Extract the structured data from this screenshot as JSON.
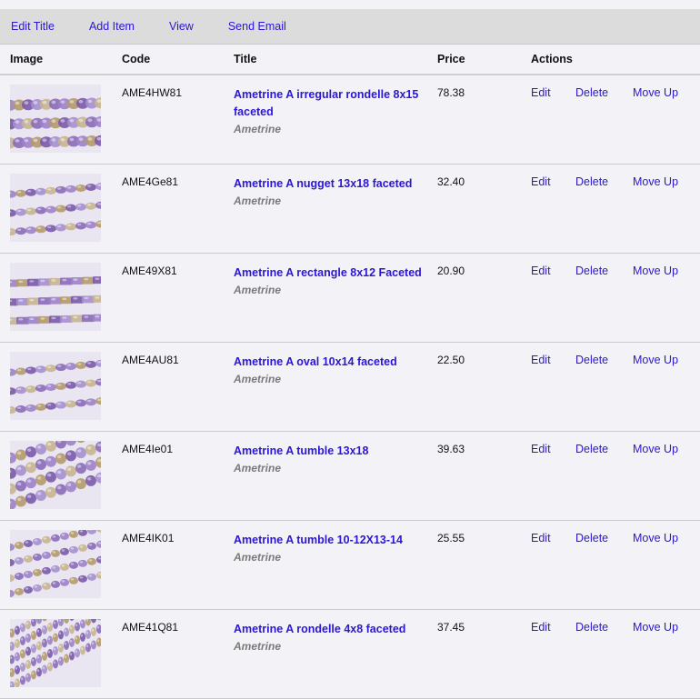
{
  "toolbar": {
    "edit_title": "Edit Title",
    "add_item": "Add Item",
    "view": "View",
    "send_email": "Send Email"
  },
  "table": {
    "headers": [
      "Image",
      "Code",
      "Title",
      "Price",
      "Actions"
    ],
    "actions": {
      "edit": "Edit",
      "delete": "Delete",
      "move_up": "Move Up"
    },
    "rows": [
      {
        "code": "AME4HW81",
        "title": "Ametrine A irregular rondelle 8x15 faceted",
        "subtitle": "Ametrine",
        "price": "78.38",
        "image": "irregular-rondelle"
      },
      {
        "code": "AME4Ge81",
        "title": "Ametrine A nugget 13x18 faceted",
        "subtitle": "Ametrine",
        "price": "32.40",
        "image": "nugget"
      },
      {
        "code": "AME49X81",
        "title": "Ametrine A rectangle 8x12 Faceted",
        "subtitle": "Ametrine",
        "price": "20.90",
        "image": "rectangle"
      },
      {
        "code": "AME4AU81",
        "title": "Ametrine A oval 10x14 faceted",
        "subtitle": "Ametrine",
        "price": "22.50",
        "image": "oval"
      },
      {
        "code": "AME4Ie01",
        "title": "Ametrine A tumble 13x18",
        "subtitle": "Ametrine",
        "price": "39.63",
        "image": "tumble"
      },
      {
        "code": "AME4IK01",
        "title": "Ametrine A tumble 10-12X13-14",
        "subtitle": "Ametrine",
        "price": "25.55",
        "image": "tumble-small"
      },
      {
        "code": "AME41Q81",
        "title": "Ametrine A rondelle 4x8 faceted",
        "subtitle": "Ametrine",
        "price": "37.45",
        "image": "rondelle"
      }
    ]
  },
  "colors": {
    "link": "#2a16d6",
    "toolbar_bg": "#dcdcdc",
    "page_bg": "#f3f3f7",
    "bead_purple": "#8a6bb8",
    "bead_amber": "#b59a6a"
  }
}
